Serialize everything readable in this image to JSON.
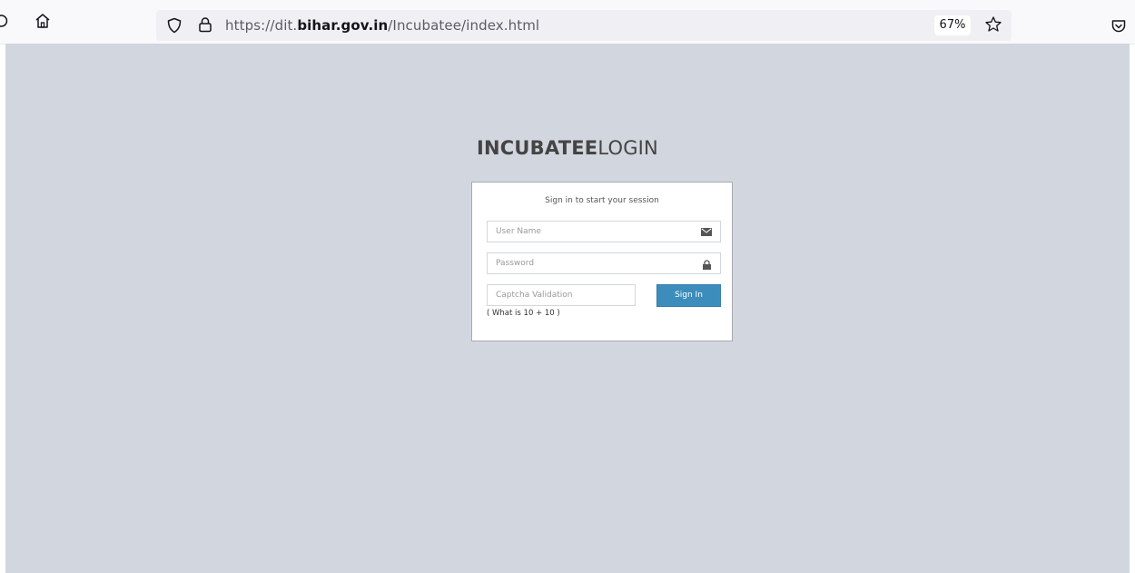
{
  "browser": {
    "url_prefix": "https://dit.",
    "url_domain": "bihar.gov.in",
    "url_path": "/Incubatee/index.html",
    "zoom": "67%",
    "icons": [
      "reload-icon",
      "home-icon",
      "shield-icon",
      "lock-icon",
      "star-icon",
      "pocket-icon"
    ]
  },
  "login": {
    "title_bold": "INCUBATEE",
    "title_light": "LOGIN",
    "message": "Sign in to start your session",
    "username_placeholder": "User Name",
    "password_placeholder": "Password",
    "captcha_placeholder": "Captcha Validation",
    "signin_label": "Sign In",
    "captcha_hint": "( What is 10 + 10 )"
  },
  "colors": {
    "page_background": "#d2d6de",
    "button": "#3c8dbc"
  }
}
